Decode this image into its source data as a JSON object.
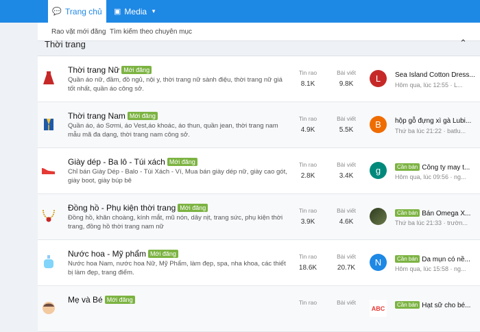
{
  "nav": {
    "home_label": "Trang chủ",
    "media_label": "Media"
  },
  "subnav": {
    "link1": "Rao vặt mới đăng",
    "link2": "Tìm kiếm theo chuyên mục"
  },
  "section": {
    "title": "Thời trang"
  },
  "colors": {
    "nav_bg": "#1e88e5",
    "badge": "#7cb342"
  },
  "forums": [
    {
      "icon": "dress-icon",
      "title": "Thời trang Nữ",
      "badge": "Mới đăng",
      "desc": "Quần áo nữ, đầm, đồ ngủ, nội y, thời trang nữ sành điệu, thời trang nữ giá tốt nhất, quần áo công sở.",
      "threads_label": "Tin rao",
      "threads": "8.1K",
      "posts_label": "Bài viết",
      "posts": "9.8K",
      "avatar_letter": "L",
      "avatar_color": "#c62828",
      "last_badge": "",
      "last_title": "Sea Island Cotton Dress...",
      "last_meta": "Hôm qua, lúc 12:55 · L..."
    },
    {
      "icon": "vest-icon",
      "title": "Thời trang Nam",
      "badge": "Mới đăng",
      "desc": "Quần áo, áo Sơmi, áo Vest,áo khoác, áo thun, quần jean, thời trang nam mẫu mã đa dạng, thời trang nam công sở.",
      "threads_label": "Tin rao",
      "threads": "4.9K",
      "posts_label": "Bài viết",
      "posts": "5.5K",
      "avatar_letter": "B",
      "avatar_color": "#ef6c00",
      "last_badge": "",
      "last_title": "hộp gỗ đựng xì gà Lubi...",
      "last_meta": "Thứ ba lúc 21:22 · batlu..."
    },
    {
      "icon": "shoe-icon",
      "title": "Giày dép - Ba lô - Túi xách",
      "badge": "Mới đăng",
      "desc": "Chỉ bán Giày Dép - Balo - Túi Xách - Ví, Mua bán giày dép nữ, giày cao gót, giày boot, giày búp bê",
      "threads_label": "Tin rao",
      "threads": "2.8K",
      "posts_label": "Bài viết",
      "posts": "3.4K",
      "avatar_letter": "g",
      "avatar_color": "#00897b",
      "last_badge": "Cần bán",
      "last_title": "Công ty may t...",
      "last_meta": "Hôm qua, lúc 09:56 · ng..."
    },
    {
      "icon": "necklace-icon",
      "title": "Đồng hồ - Phụ kiện thời trang",
      "badge": "Mới đăng",
      "desc": "Đồng hồ, khăn choàng, kính mắt, mũ nón, dây nịt, trang sức, phụ kiện thời trang, đồng hồ thời trang nam nữ",
      "threads_label": "Tin rao",
      "threads": "3.9K",
      "posts_label": "Bài viết",
      "posts": "4.6K",
      "avatar_letter": "",
      "avatar_color": "#4e5b3a",
      "last_badge": "Cần bán",
      "last_title": "Bán Omega X...",
      "last_meta": "Thứ ba lúc 21:33 · trườn..."
    },
    {
      "icon": "perfume-icon",
      "title": "Nước hoa - Mỹ phẩm",
      "badge": "Mới đăng",
      "desc": "Nước hoa Nam, nước hoa Nữ, Mỹ Phẩm, làm đẹp, spa, nha khoa, các thiết bị làm đẹp, trang điểm.",
      "threads_label": "Tin rao",
      "threads": "18.6K",
      "posts_label": "Bài viết",
      "posts": "20.7K",
      "avatar_letter": "N",
      "avatar_color": "#1e88e5",
      "last_badge": "Cần bán",
      "last_title": "Da mụn có nề...",
      "last_meta": "Hôm qua, lúc 15:58 · ng..."
    },
    {
      "icon": "baby-icon",
      "title": "Mẹ và Bé",
      "badge": "Mới đăng",
      "desc": "",
      "threads_label": "Tin rao",
      "threads": "",
      "posts_label": "Bài viết",
      "posts": "",
      "avatar_letter": "ABC",
      "avatar_color": "#ffffff",
      "last_badge": "Cần bán",
      "last_title": "Hạt sữ cho bé...",
      "last_meta": ""
    }
  ]
}
